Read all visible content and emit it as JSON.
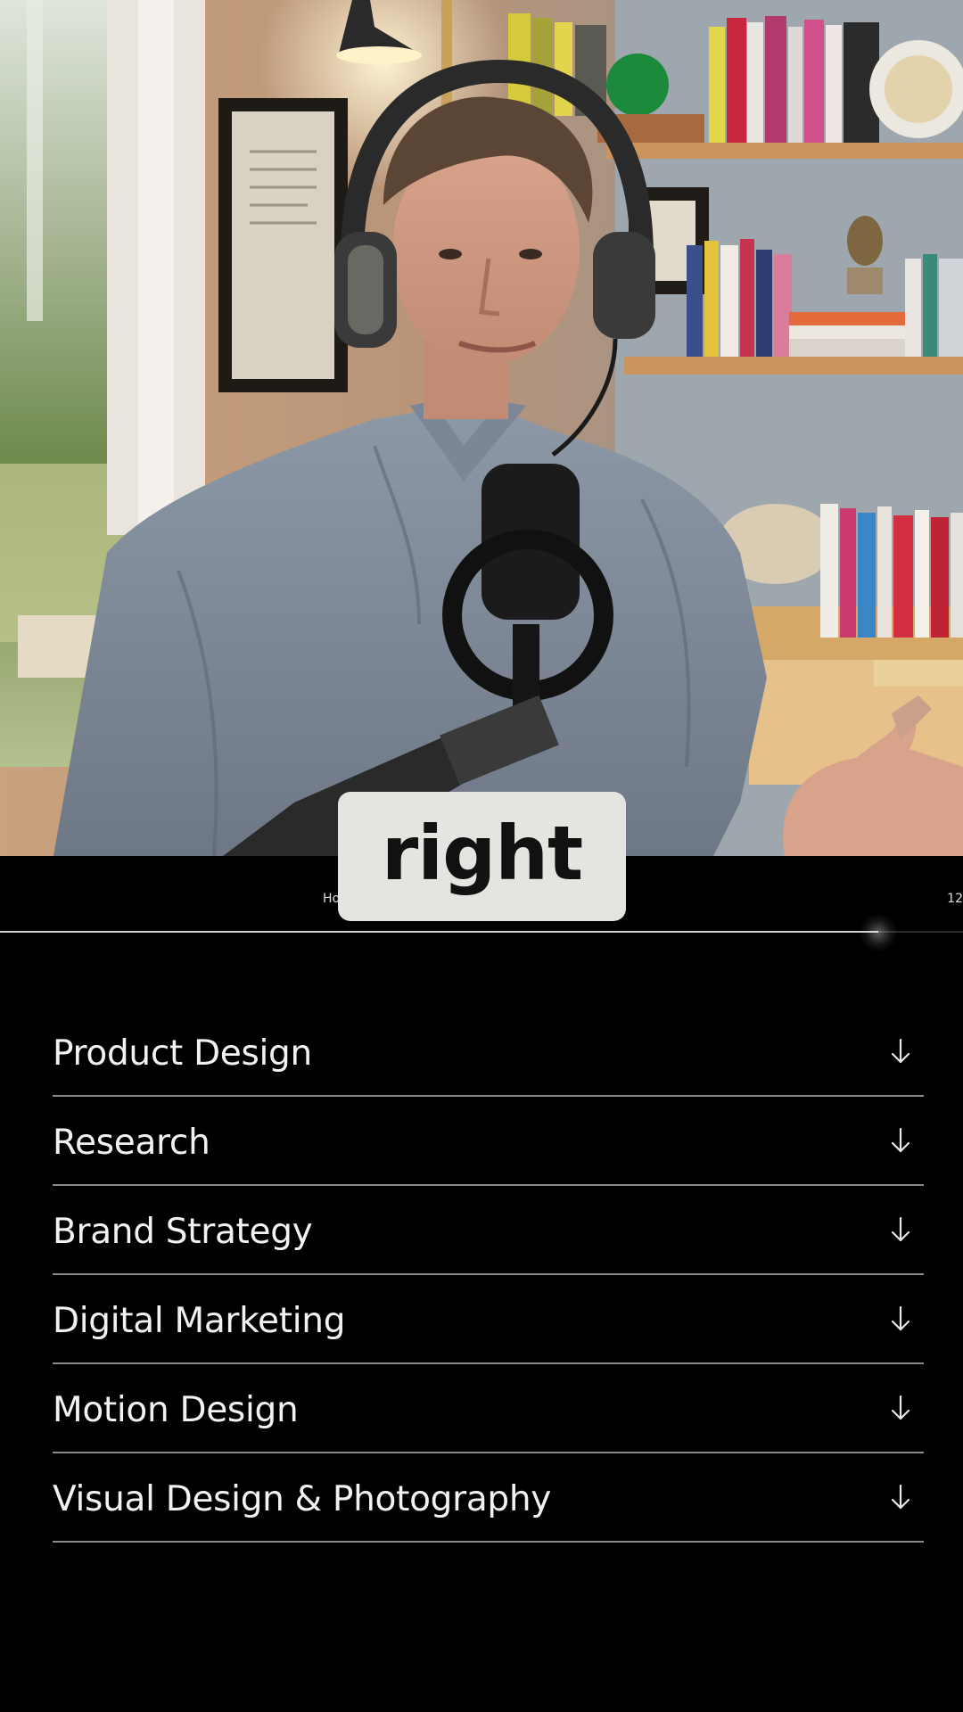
{
  "caption": {
    "text": "right"
  },
  "nav": {
    "left_fragment": "Ho",
    "right_fragment": "12"
  },
  "progress": {
    "fraction": 0.912
  },
  "services": {
    "items": [
      {
        "label": "Product Design",
        "icon": "arrow-down-icon"
      },
      {
        "label": "Research",
        "icon": "arrow-down-icon"
      },
      {
        "label": "Brand Strategy",
        "icon": "arrow-down-icon"
      },
      {
        "label": "Digital Marketing",
        "icon": "arrow-down-icon"
      },
      {
        "label": "Motion Design",
        "icon": "arrow-down-icon"
      },
      {
        "label": "Visual Design & Photography",
        "icon": "arrow-down-icon"
      }
    ]
  },
  "colors": {
    "background": "#000000",
    "caption_bg": "#e4e4e1",
    "caption_text": "#111111",
    "divider": "#8a8a8a",
    "label": "#f2f2f2"
  }
}
